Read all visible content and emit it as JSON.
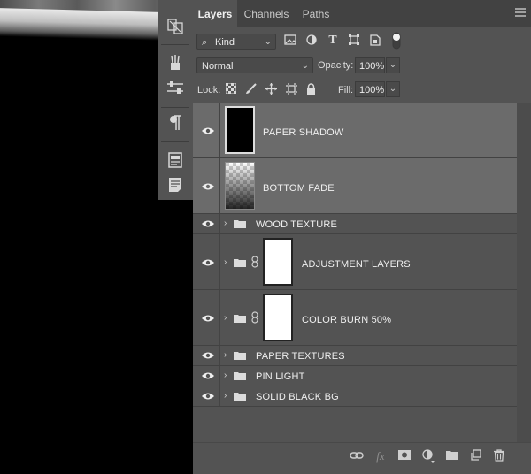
{
  "tabs": [
    {
      "label": "Layers",
      "active": true
    },
    {
      "label": "Channels",
      "active": false
    },
    {
      "label": "Paths",
      "active": false
    }
  ],
  "filter": {
    "kind_label": "Kind"
  },
  "blend": {
    "mode": "Normal",
    "opacity_label": "Opacity:",
    "opacity_value": "100%"
  },
  "lock": {
    "label": "Lock:",
    "fill_label": "Fill:",
    "fill_value": "100%"
  },
  "layers": [
    {
      "name": "PAPER SHADOW",
      "type": "layer",
      "selected": true
    },
    {
      "name": "BOTTOM FADE",
      "type": "layer",
      "selected": true
    },
    {
      "name": "WOOD TEXTURE",
      "type": "group"
    },
    {
      "name": "ADJUSTMENT LAYERS",
      "type": "group-masked"
    },
    {
      "name": "COLOR BURN 50%",
      "type": "group-masked"
    },
    {
      "name": "PAPER TEXTURES",
      "type": "group"
    },
    {
      "name": "PIN LIGHT",
      "type": "group"
    },
    {
      "name": "SOLID BLACK BG",
      "type": "group"
    }
  ],
  "footer_icons": [
    "link-layers-icon",
    "fx-icon",
    "add-mask-icon",
    "adjustment-layer-icon",
    "new-group-icon",
    "new-layer-icon",
    "delete-icon"
  ],
  "colors": {
    "panel": "#535353",
    "selected_row": "#6b6b6b",
    "tab_bar": "#424242"
  }
}
